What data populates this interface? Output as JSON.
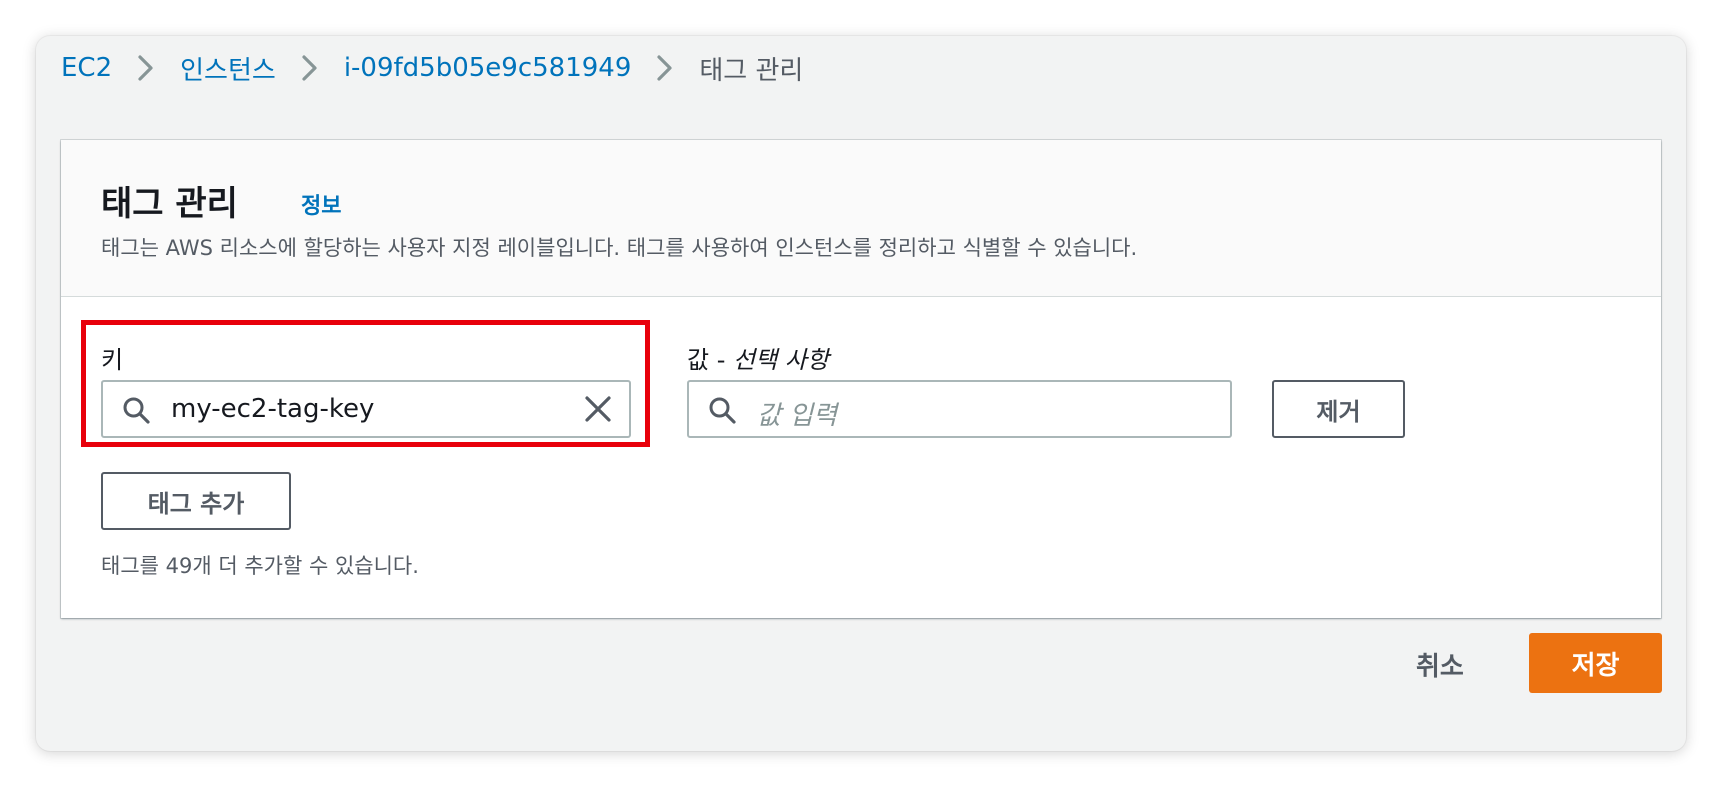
{
  "breadcrumb": {
    "items": [
      {
        "label": "EC2"
      },
      {
        "label": "인스턴스"
      },
      {
        "label": "i-09fd5b05e9c581949"
      }
    ],
    "current": "태그 관리"
  },
  "panel": {
    "title": "태그 관리",
    "info_link": "정보",
    "description": "태그는 AWS 리소스에 할당하는 사용자 지정 레이블입니다. 태그를 사용하여 인스턴스를 정리하고 식별할 수 있습니다."
  },
  "tag_row": {
    "key_label": "키",
    "key_value": "my-ec2-tag-key",
    "value_label": "값 - ",
    "value_label_optional": "선택 사항",
    "value_placeholder": "값 입력",
    "remove_label": "제거"
  },
  "add_tag_label": "태그 추가",
  "remaining_hint": "태그를 49개 더 추가할 수 있습니다.",
  "footer": {
    "cancel_label": "취소",
    "save_label": "저장"
  },
  "colors": {
    "link": "#0073bb",
    "primary": "#ec7211",
    "highlight": "#e8000b",
    "background": "#f2f3f3"
  },
  "icons": [
    "chevron-right-icon",
    "search-icon",
    "close-icon"
  ]
}
